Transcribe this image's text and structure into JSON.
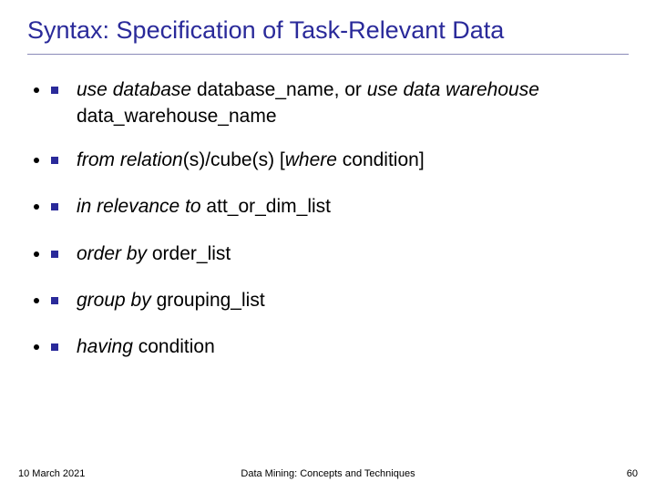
{
  "title": "Syntax: Specification of Task-Relevant Data",
  "bullets": {
    "b1": {
      "t1": "use database",
      "t2": " database_name, or ",
      "t3": "use data warehouse",
      "t4": " data_warehouse_name"
    },
    "b2": {
      "t1": "from relation",
      "t2": "(s)/cube(s) [",
      "t3": "where",
      "t4": " condition]"
    },
    "b3": {
      "t1": "in relevance to",
      "t2": " att_or_dim_list"
    },
    "b4": {
      "t1": "order by",
      "t2": " order_list"
    },
    "b5": {
      "t1": "group by",
      "t2": " grouping_list"
    },
    "b6": {
      "t1": "having",
      "t2": " condition"
    }
  },
  "footer": {
    "date": "10 March 2021",
    "center": "Data Mining: Concepts and Techniques",
    "page": "60"
  }
}
